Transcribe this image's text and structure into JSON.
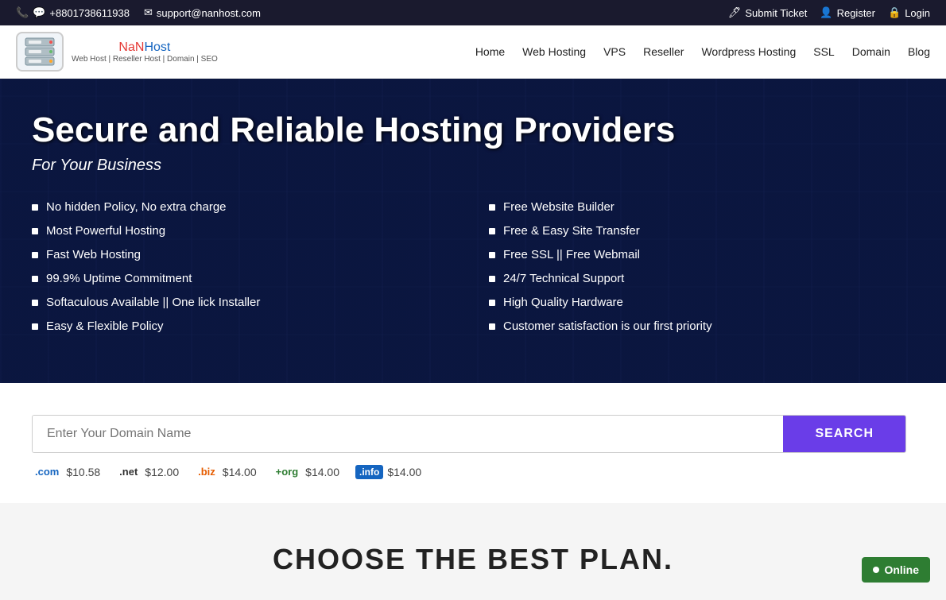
{
  "topbar": {
    "phone_icon": "📞",
    "whatsapp_icon": "💬",
    "phone": "+8801738611938",
    "email_icon": "✉",
    "email": "support@nanhost.com",
    "ticket_icon": "🖊",
    "ticket_label": "Submit Ticket",
    "register_icon": "👤",
    "register_label": "Register",
    "lock_icon": "🔒",
    "login_label": "Login"
  },
  "header": {
    "logo_icon": "🖥",
    "logo_nan": "NaN",
    "logo_host": "Host",
    "logo_sub": "Web Host | Reseller Host | Domain | SEO",
    "nav": [
      {
        "label": "Home",
        "href": "#"
      },
      {
        "label": "Web Hosting",
        "href": "#"
      },
      {
        "label": "VPS",
        "href": "#"
      },
      {
        "label": "Reseller",
        "href": "#"
      },
      {
        "label": "Wordpress Hosting",
        "href": "#"
      },
      {
        "label": "SSL",
        "href": "#"
      },
      {
        "label": "Domain",
        "href": "#"
      },
      {
        "label": "Blog",
        "href": "#"
      }
    ]
  },
  "hero": {
    "title": "Secure and Reliable Hosting Providers",
    "subtitle": "For Your Business",
    "left_features": [
      "No hidden Policy, No extra charge",
      "Most Powerful Hosting",
      "Fast Web Hosting",
      "99.9% Uptime Commitment",
      "Softaculous Available || One lick Installer",
      "Easy & Flexible Policy"
    ],
    "right_features": [
      "Free Website Builder",
      "Free & Easy Site Transfer",
      "Free SSL || Free Webmail",
      "24/7 Technical Support",
      "High Quality Hardware",
      "Customer satisfaction is our first priority"
    ]
  },
  "domain_search": {
    "placeholder": "Enter Your Domain Name",
    "button_label": "SEARCH",
    "tlds": [
      {
        "name": ".com",
        "price": "$10.58",
        "type": "com"
      },
      {
        "name": ".net",
        "price": "$12.00",
        "type": "net"
      },
      {
        "name": ".biz",
        "price": "$14.00",
        "type": "biz"
      },
      {
        "name": "+org",
        "price": "$14.00",
        "type": "org"
      },
      {
        "name": ".info",
        "price": "$14.00",
        "type": "info"
      }
    ]
  },
  "bottom": {
    "title": "CHOOSE THE BEST PLAN."
  },
  "online_badge": {
    "label": "Online"
  }
}
